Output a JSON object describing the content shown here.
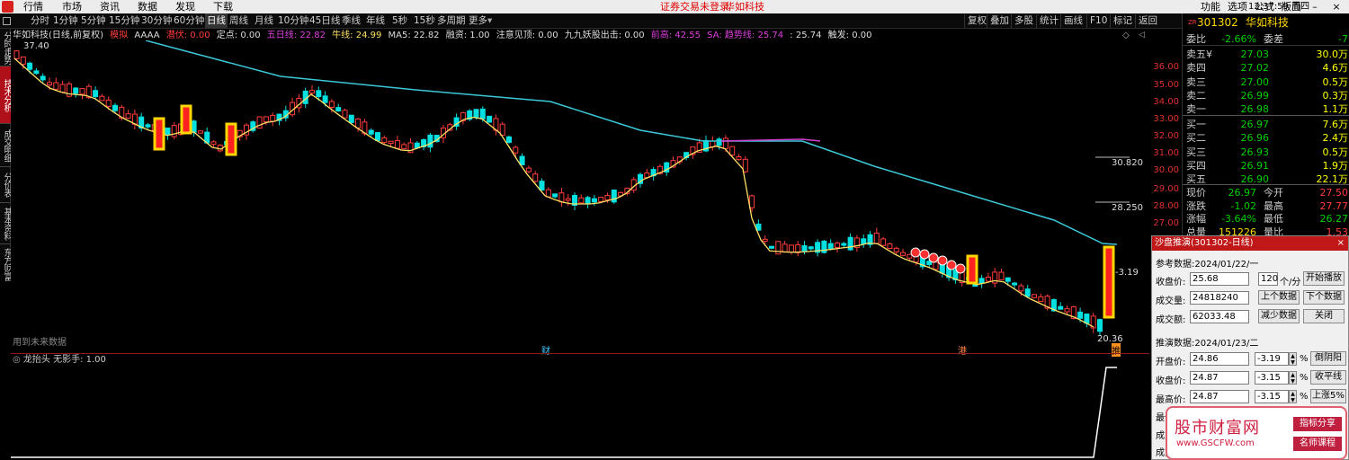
{
  "menubar": {
    "items": [
      "行情",
      "市场",
      "资讯",
      "数据",
      "发现",
      "下载"
    ],
    "center_status": "证券交易未登录",
    "center_stock": "华如科技",
    "right_items": [
      "功能",
      "选项",
      "公式",
      "版面"
    ]
  },
  "toolbar": {
    "periods": [
      "分时",
      "1分钟",
      "5分钟",
      "15分钟",
      "30分钟",
      "60分钟",
      "日线",
      "周线",
      "月线",
      "10分钟",
      "45日线",
      "季线",
      "年线",
      "5秒",
      "15秒",
      "多周期",
      "更多"
    ],
    "active_period": "日线",
    "right_buttons": [
      "复权",
      "叠加",
      "多股",
      "统计",
      "画线",
      "F10",
      "标记",
      "返回"
    ],
    "time": "12:37:59",
    "weekday": "周四"
  },
  "sidetabs": [
    "分时走势",
    "技术分析",
    "成交明细",
    "分价表",
    "基本资料",
    "东方财富"
  ],
  "active_sidetab": "技术分析",
  "chart_header": {
    "stock": "华如科技(日线,前复权)",
    "mode": "模拟",
    "aaaa": "AAAA",
    "qianfu": "潜伏: 0.00",
    "dingdian": "定点: 0.00",
    "wuri": "五日线: 22.82",
    "niuxian": "牛线: 24.99",
    "ma5": "MA5: 22.82",
    "rongzi": "融资: 1.00",
    "zhuyi": "注意见顶: 0.00",
    "jiujiu": "九九妖股出击: 0.00",
    "qiangao": "前高: 42.55",
    "sa": "SA: ",
    "qushi": "趋势线: 25.74",
    "val2": ": 25.74",
    "chufa": "触发: 0.00"
  },
  "chart_labels": {
    "high_label": "37.40",
    "low_label": "20.36",
    "pct_label": "-3.19",
    "line1": "30.820",
    "line2": "28.250",
    "note": "用到未来数据",
    "marker_cai": "财",
    "marker_gang": "港",
    "marker_tui": "推"
  },
  "price_ticks": [
    "36.00",
    "35.00",
    "34.00",
    "33.00",
    "32.00",
    "31.00",
    "30.00",
    "29.00",
    "28.00",
    "27.00"
  ],
  "sub_header": {
    "name": "龙抬头",
    "value": "无影手: 1.00"
  },
  "chart_data": [
    {
      "type": "candlestick",
      "title": "华如科技(日线,前复权)",
      "ylim": [
        20.36,
        37.4
      ],
      "series": [
        {
          "name": "MA5",
          "color": "#ffe066"
        },
        {
          "name": "趋势线",
          "color": "#3cc8d8"
        }
      ],
      "annotations": [
        "30.820",
        "28.250",
        "-3.19",
        "37.40",
        "20.36"
      ]
    },
    {
      "type": "line",
      "title": "龙抬头",
      "series": [
        {
          "name": "无影手",
          "values_end": 1.0,
          "color": "#ffffff"
        }
      ]
    }
  ],
  "quote": {
    "code_prefix": "ZR",
    "code": "301302",
    "name": "华如科技",
    "weibi_label": "委比",
    "weibi": "-2.66%",
    "weicha_label": "委差",
    "weicha": "-7",
    "asks": [
      {
        "label": "卖五",
        "mark": "¥",
        "price": "27.03",
        "vol": "30.0万"
      },
      {
        "label": "卖四",
        "mark": "",
        "price": "27.02",
        "vol": "4.6万"
      },
      {
        "label": "卖三",
        "mark": "",
        "price": "27.00",
        "vol": "0.5万"
      },
      {
        "label": "卖二",
        "mark": "",
        "price": "26.99",
        "vol": "0.3万"
      },
      {
        "label": "卖一",
        "mark": "",
        "price": "26.98",
        "vol": "1.1万"
      }
    ],
    "bids": [
      {
        "label": "买一",
        "price": "26.97",
        "vol": "7.6万"
      },
      {
        "label": "买二",
        "price": "26.96",
        "vol": "2.4万"
      },
      {
        "label": "买三",
        "price": "26.93",
        "vol": "0.5万"
      },
      {
        "label": "买四",
        "price": "26.91",
        "vol": "1.9万"
      },
      {
        "label": "买五",
        "price": "26.90",
        "vol": "22.1万"
      }
    ],
    "stats": [
      {
        "l1": "现价",
        "v1": "26.97",
        "l2": "今开",
        "v2": "27.50"
      },
      {
        "l1": "涨跌",
        "v1": "-1.02",
        "l2": "最高",
        "v2": "27.77"
      },
      {
        "l1": "涨幅",
        "v1": "-3.64%",
        "l2": "最低",
        "v2": "26.27"
      },
      {
        "l1": "总量",
        "v1": "151226",
        "l2": "量比",
        "v2": "1.53"
      }
    ]
  },
  "panel": {
    "title": "沙盘推演(301302-日线)",
    "ref_label": "参考数据:2024/01/22/一",
    "close_label": "收盘价:",
    "close_val": "25.68",
    "speed": "120",
    "speed_unit": "个/分",
    "start_btn": "开始播放",
    "vol_label": "成交量:",
    "vol_val": "24818240",
    "prev_btn": "上个数据",
    "next_btn": "下个数据",
    "amt_label": "成交额:",
    "amt_val": "62033.48",
    "less_btn": "减少数据",
    "close_btn": "关闭",
    "push_label": "推演数据:2024/01/23/二",
    "open_label": "开盘价:",
    "open_val": "24.86",
    "open_pct": "-3.19",
    "open_btn": "倒阴阳",
    "pclose_label": "收盘价:",
    "pclose_val": "24.87",
    "pclose_pct": "-3.15",
    "pclose_btn": "收平线",
    "high_label": "最高价:",
    "high_val": "24.87",
    "high_pct": "-3.15",
    "high_btn": "上涨5%",
    "pct_sign": "%",
    "low_label": "最低",
    "vol2_label": "成交",
    "amt2_label": "成交"
  },
  "ad": {
    "text1": "股市财富网",
    "text2": "www.GSCFW.com",
    "badge1": "指标分享",
    "badge2": "名师课程"
  }
}
